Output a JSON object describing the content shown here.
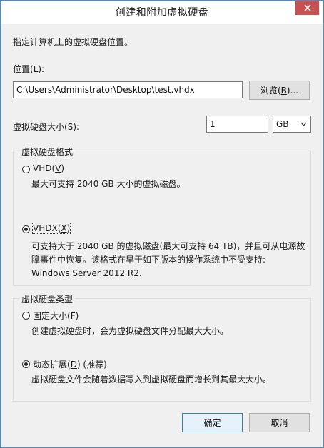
{
  "window": {
    "title": "创建和附加虚拟硬盘"
  },
  "intro": "指定计算机上的虚拟硬盘位置。",
  "location": {
    "label_prefix": "位置(",
    "label_key": "L",
    "label_suffix": "):",
    "value": "C:\\Users\\Administrator\\Desktop\\test.vhdx",
    "browse_prefix": "浏览(",
    "browse_key": "B",
    "browse_suffix": ")..."
  },
  "size": {
    "label_prefix": "虚拟硬盘大小(",
    "label_key": "S",
    "label_suffix": "):",
    "value": "1",
    "unit": "GB"
  },
  "format": {
    "group_title": "虚拟硬盘格式",
    "vhd": {
      "label_prefix": "VHD(",
      "label_key": "V",
      "label_suffix": ")",
      "checked": false,
      "desc": [
        "最大可支持 2040 GB 大小的虚拟磁盘。"
      ]
    },
    "vhdx": {
      "label_prefix": "VHDX(",
      "label_key": "X",
      "label_suffix": ")",
      "checked": true,
      "desc": [
        "可支持大于 2040 GB 的虚拟磁盘(最大可支持 64 TB)，并且可从电源故",
        "障事件中恢复。该格式在早于如下版本的操作系统中不受支持:",
        "Windows Server 2012 R2."
      ]
    }
  },
  "type": {
    "group_title": "虚拟硬盘类型",
    "fixed": {
      "label_prefix": "固定大小(",
      "label_key": "F",
      "label_suffix": ")",
      "checked": false,
      "desc": [
        "创建虚拟硬盘时，会为虚拟硬盘文件分配最大大小。"
      ]
    },
    "dynamic": {
      "label_prefix": "动态扩展(",
      "label_key": "D",
      "label_suffix": ") (推荐)",
      "checked": true,
      "desc": [
        "虚拟硬盘文件会随着数据写入到虚拟硬盘而增长到其最大大小。"
      ]
    }
  },
  "buttons": {
    "ok": "确定",
    "cancel": "取消"
  },
  "icons": {
    "close": "close-icon",
    "dropdown": "chevron-down-icon"
  },
  "colors": {
    "window_border": "#3c8fd1",
    "close_button": "#c75050",
    "default_button_border": "#3c7fb1"
  }
}
